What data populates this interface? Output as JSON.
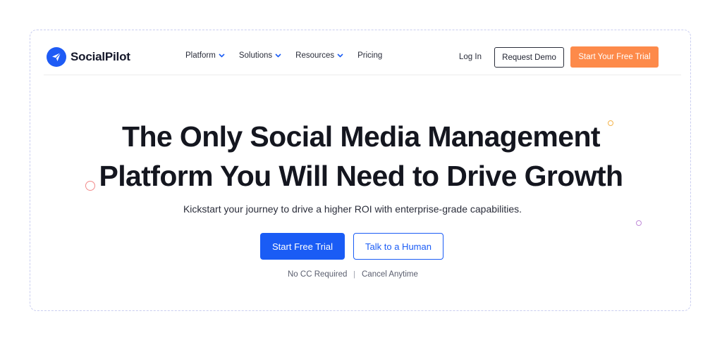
{
  "header": {
    "logo_text": "SocialPilot",
    "menu": [
      {
        "label": "Platform"
      },
      {
        "label": "Solutions"
      },
      {
        "label": "Resources"
      },
      {
        "label": "Pricing"
      }
    ],
    "login_label": "Log In",
    "demo_label": "Request Demo",
    "trial_label": "Start Your Free Trial"
  },
  "hero": {
    "title_line1": "The Only Social Media Management",
    "title_line2": "Platform You Will Need to Drive Growth",
    "subtitle": "Kickstart your journey to drive a higher ROI with enterprise-grade capabilities.",
    "primary_cta": "Start Free Trial",
    "secondary_cta": "Talk to a Human",
    "note_left": "No CC Required",
    "note_separator": "|",
    "note_right": "Cancel Anytime"
  },
  "colors": {
    "brand_blue": "#1a5cf5",
    "accent_orange": "#fd8a4a",
    "text_dark": "#14161f"
  },
  "icons": {
    "logo": "paper-plane-icon",
    "dropdown": "chevron-down-icon"
  }
}
